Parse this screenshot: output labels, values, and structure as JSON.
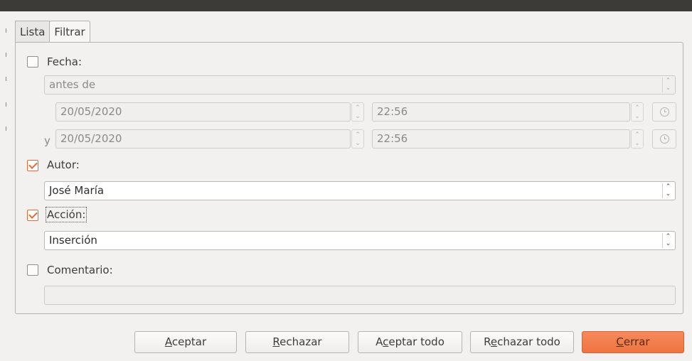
{
  "tabs": [
    {
      "label": "Lista"
    },
    {
      "label": "Filtrar"
    }
  ],
  "fecha": {
    "label": "Fecha:",
    "checked": false,
    "condition": "antes de",
    "start_date": "20/05/2020",
    "start_time": "22:56",
    "and_label": "y",
    "end_date": "20/05/2020",
    "end_time": "22:56"
  },
  "autor": {
    "label": "Autor:",
    "checked": true,
    "value": "José María"
  },
  "accion": {
    "label": "Acción:",
    "checked": true,
    "value": "Inserción"
  },
  "comentario": {
    "label": "Comentario:",
    "checked": false,
    "value": ""
  },
  "buttons": {
    "accept": {
      "pre": "",
      "mn": "A",
      "post": "ceptar"
    },
    "reject": {
      "pre": "",
      "mn": "R",
      "post": "echazar"
    },
    "accept_all": {
      "pre": "A",
      "mn": "c",
      "post": "eptar todo"
    },
    "reject_all": {
      "pre": "R",
      "mn": "e",
      "post": "chazar todo"
    },
    "close": {
      "pre": "",
      "mn": "C",
      "post": "errar"
    }
  },
  "colors": {
    "accent": "#e46b38",
    "primary_button": "#f07a46",
    "title_bar": "#3c3b37"
  }
}
